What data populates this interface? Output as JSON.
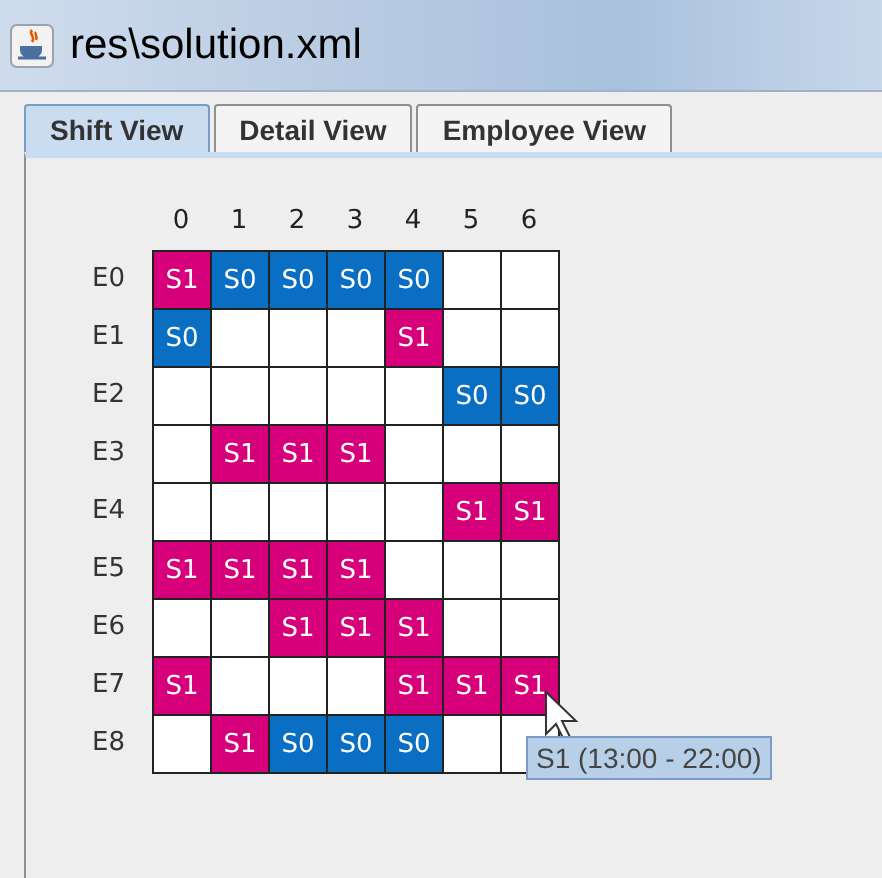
{
  "window": {
    "title": "res\\solution.xml"
  },
  "tabs": [
    {
      "label": "Shift View",
      "selected": true
    },
    {
      "label": "Detail View",
      "selected": false
    },
    {
      "label": "Employee View",
      "selected": false
    }
  ],
  "grid": {
    "columns": [
      "0",
      "1",
      "2",
      "3",
      "4",
      "5",
      "6"
    ],
    "rows": [
      {
        "label": "E0",
        "cells": [
          {
            "kind": "s1",
            "text": "S1"
          },
          {
            "kind": "s0",
            "text": "S0"
          },
          {
            "kind": "s0",
            "text": "S0"
          },
          {
            "kind": "s0",
            "text": "S0"
          },
          {
            "kind": "s0",
            "text": "S0"
          },
          {
            "kind": "empty"
          },
          {
            "kind": "empty"
          }
        ]
      },
      {
        "label": "E1",
        "cells": [
          {
            "kind": "s0",
            "text": "S0"
          },
          {
            "kind": "empty"
          },
          {
            "kind": "empty"
          },
          {
            "kind": "empty"
          },
          {
            "kind": "s1",
            "text": "S1"
          },
          {
            "kind": "empty"
          },
          {
            "kind": "empty"
          }
        ]
      },
      {
        "label": "E2",
        "cells": [
          {
            "kind": "empty"
          },
          {
            "kind": "empty"
          },
          {
            "kind": "empty"
          },
          {
            "kind": "empty"
          },
          {
            "kind": "empty"
          },
          {
            "kind": "s0",
            "text": "S0"
          },
          {
            "kind": "s0",
            "text": "S0"
          }
        ]
      },
      {
        "label": "E3",
        "cells": [
          {
            "kind": "empty"
          },
          {
            "kind": "s1",
            "text": "S1"
          },
          {
            "kind": "s1",
            "text": "S1"
          },
          {
            "kind": "s1",
            "text": "S1"
          },
          {
            "kind": "empty"
          },
          {
            "kind": "empty"
          },
          {
            "kind": "empty"
          }
        ]
      },
      {
        "label": "E4",
        "cells": [
          {
            "kind": "empty"
          },
          {
            "kind": "empty"
          },
          {
            "kind": "empty"
          },
          {
            "kind": "empty"
          },
          {
            "kind": "empty"
          },
          {
            "kind": "s1",
            "text": "S1"
          },
          {
            "kind": "s1",
            "text": "S1"
          }
        ]
      },
      {
        "label": "E5",
        "cells": [
          {
            "kind": "s1",
            "text": "S1"
          },
          {
            "kind": "s1",
            "text": "S1"
          },
          {
            "kind": "s1",
            "text": "S1"
          },
          {
            "kind": "s1",
            "text": "S1"
          },
          {
            "kind": "empty"
          },
          {
            "kind": "empty"
          },
          {
            "kind": "empty"
          }
        ]
      },
      {
        "label": "E6",
        "cells": [
          {
            "kind": "empty"
          },
          {
            "kind": "empty"
          },
          {
            "kind": "s1",
            "text": "S1"
          },
          {
            "kind": "s1",
            "text": "S1"
          },
          {
            "kind": "s1",
            "text": "S1"
          },
          {
            "kind": "empty"
          },
          {
            "kind": "empty"
          }
        ]
      },
      {
        "label": "E7",
        "cells": [
          {
            "kind": "s1",
            "text": "S1"
          },
          {
            "kind": "empty"
          },
          {
            "kind": "empty"
          },
          {
            "kind": "empty"
          },
          {
            "kind": "s1",
            "text": "S1"
          },
          {
            "kind": "s1",
            "text": "S1"
          },
          {
            "kind": "s1",
            "text": "S1"
          }
        ]
      },
      {
        "label": "E8",
        "cells": [
          {
            "kind": "empty"
          },
          {
            "kind": "s1",
            "text": "S1"
          },
          {
            "kind": "s0",
            "text": "S0"
          },
          {
            "kind": "s0",
            "text": "S0"
          },
          {
            "kind": "s0",
            "text": "S0"
          },
          {
            "kind": "empty"
          },
          {
            "kind": "empty"
          }
        ]
      }
    ]
  },
  "tooltip": {
    "text": "S1 (13:00 - 22:00)"
  }
}
